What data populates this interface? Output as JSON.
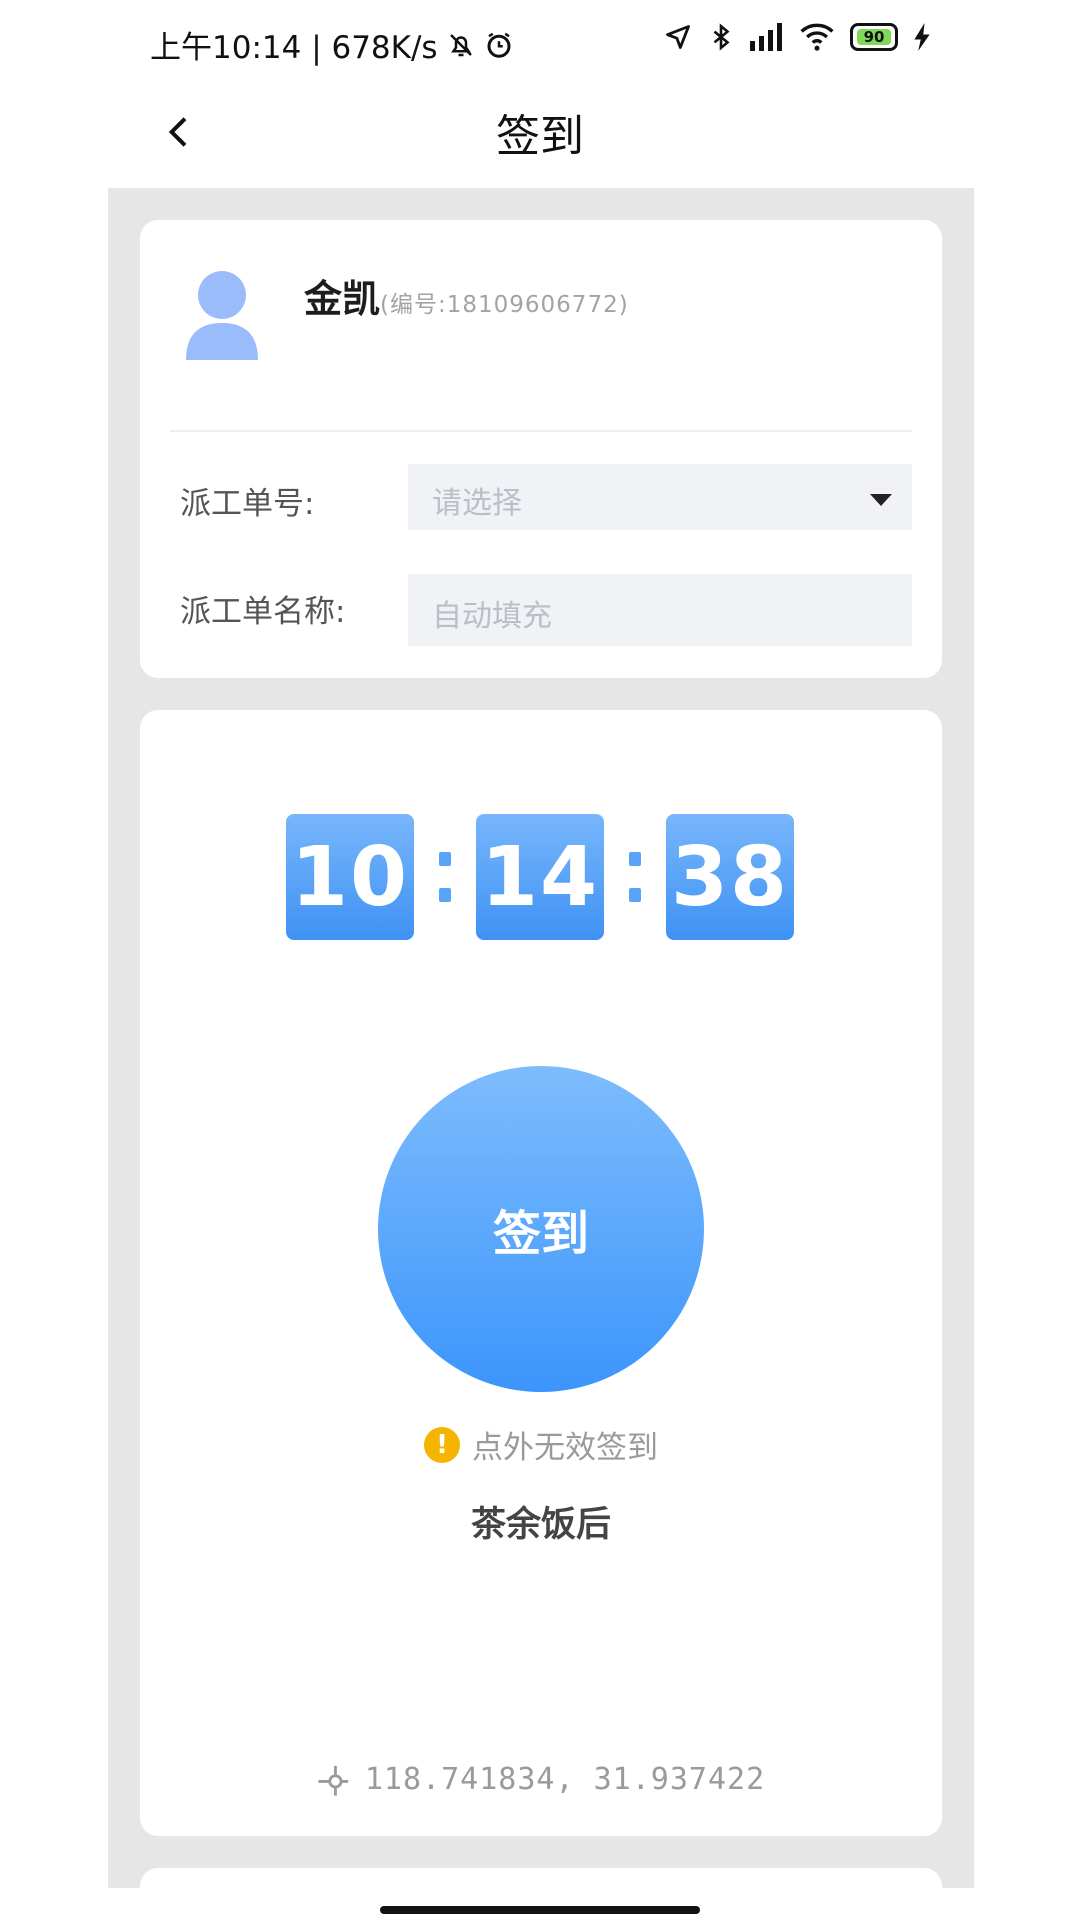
{
  "status_bar": {
    "left_text": "上午10:14 | 678K/s",
    "battery": "90",
    "icons": [
      "bell-off-icon",
      "alarm-icon",
      "location-arrow-icon",
      "bluetooth-icon",
      "signal-icon",
      "wifi-icon",
      "battery-icon",
      "charging-icon"
    ]
  },
  "header": {
    "title": "签到",
    "back_icon": "chevron-left-icon"
  },
  "profile": {
    "name": "金凯",
    "id_text": "(编号:18109606772)",
    "avatar_color": "#9bbcfb"
  },
  "form": {
    "order_no": {
      "label": "派工单号:",
      "placeholder": "请选择"
    },
    "order_name": {
      "label": "派工单名称:",
      "placeholder": "自动填充"
    }
  },
  "clock": {
    "hours": "10",
    "minutes": "14",
    "seconds": "38"
  },
  "checkin": {
    "button_label": "签到",
    "warning_text": "点外无效签到",
    "location_name": "茶余饭后",
    "coordinates": "118.741834, 31.937422"
  },
  "colors": {
    "accent": "#3f92f4",
    "warning": "#f5b400",
    "background": "#e6e6e6"
  }
}
